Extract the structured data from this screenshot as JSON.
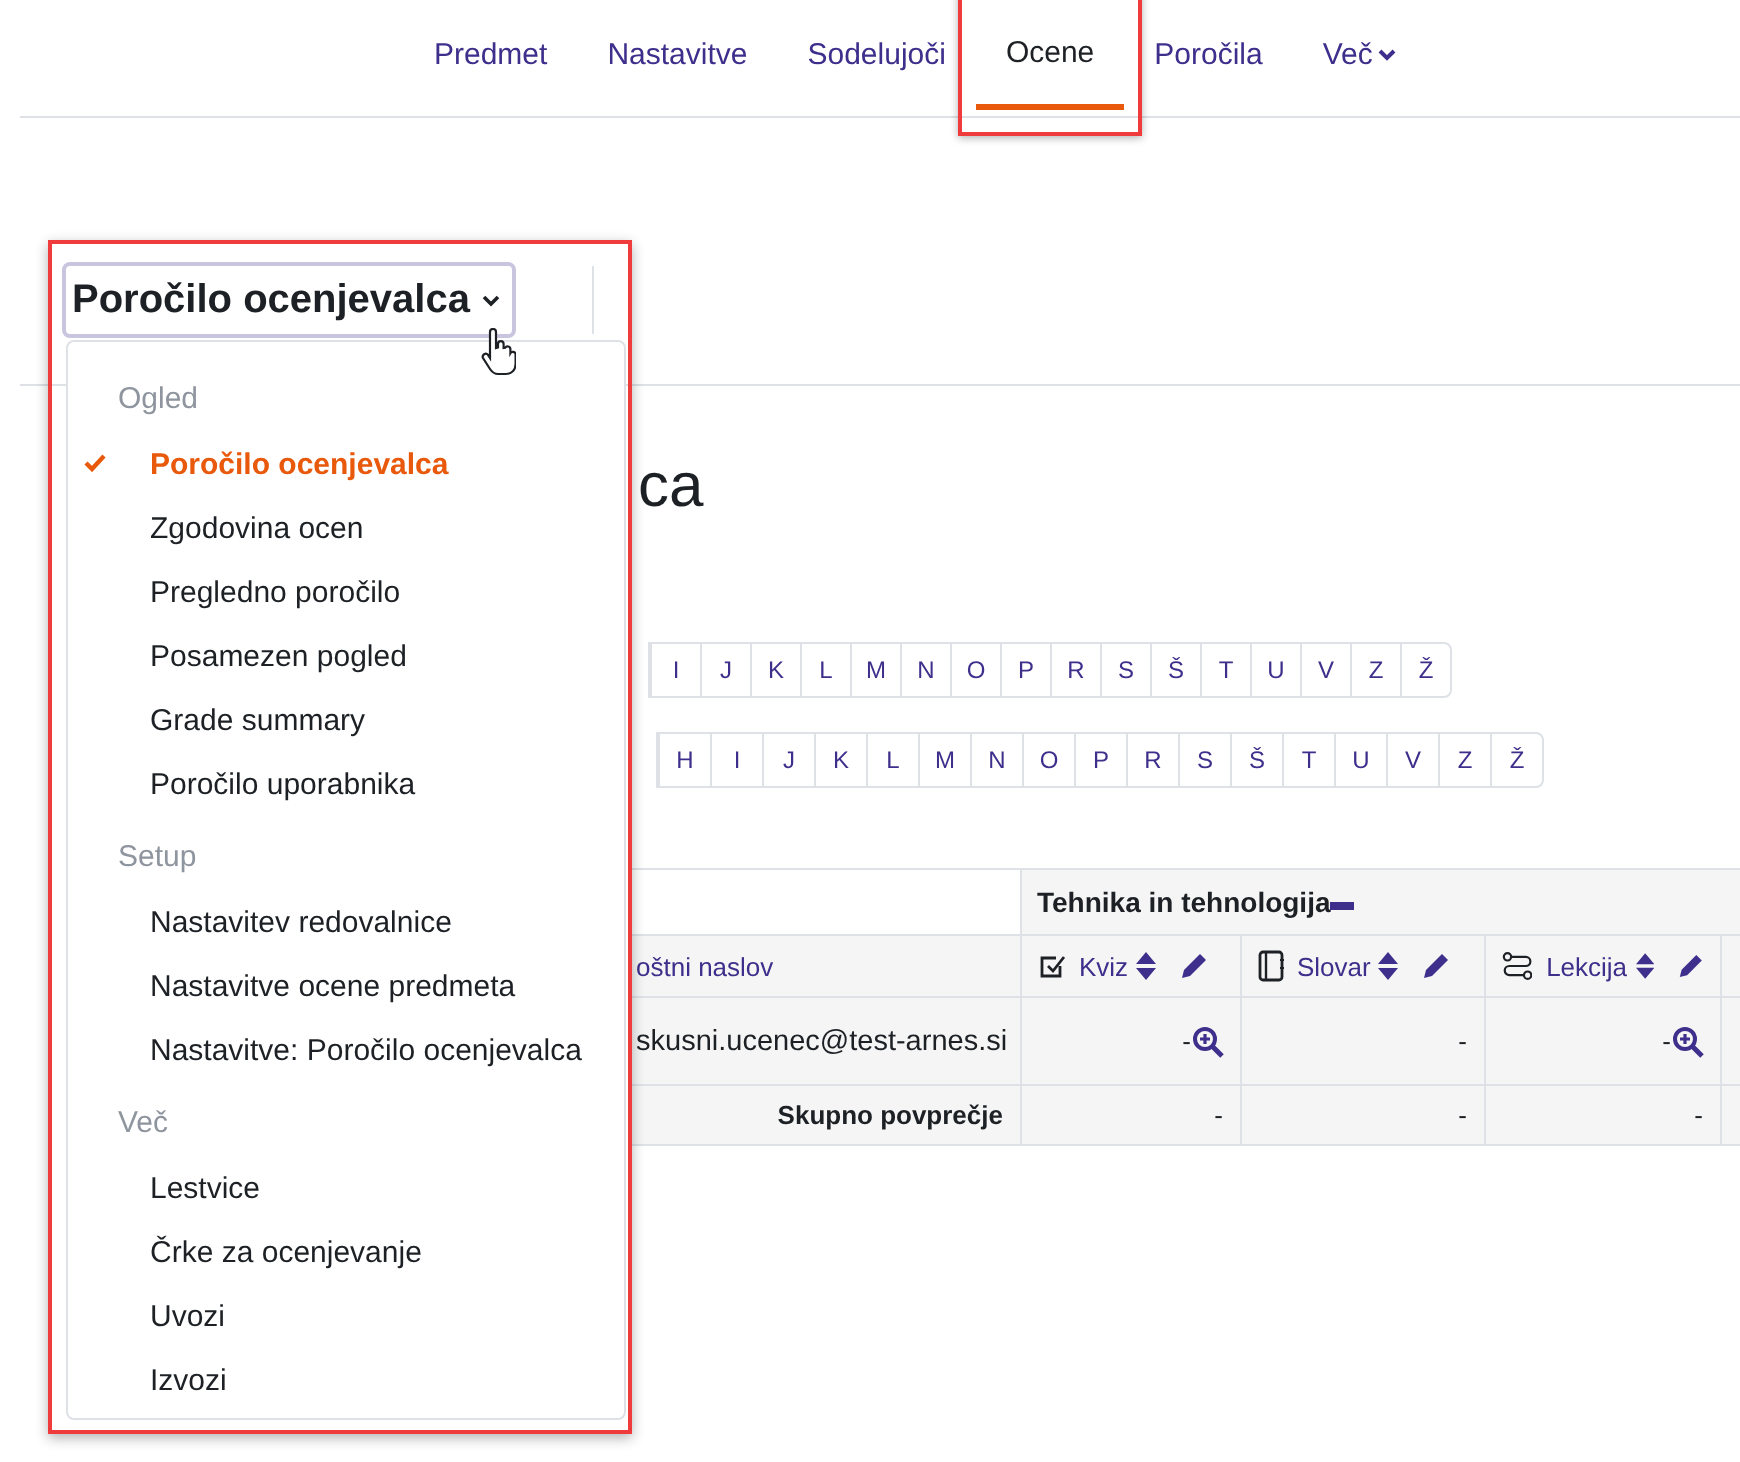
{
  "nav": {
    "tabs": [
      {
        "label": "Predmet",
        "selected": false
      },
      {
        "label": "Nastavitve",
        "selected": false
      },
      {
        "label": "Sodelujoči",
        "selected": false
      },
      {
        "label": "Ocene",
        "selected": true,
        "highlighted": true
      },
      {
        "label": "Poročila",
        "selected": false
      },
      {
        "label": "Več",
        "selected": false,
        "dropdown": true
      }
    ]
  },
  "report_selector": {
    "label": "Poročilo ocenjevalca",
    "highlighted": true,
    "expanded": true,
    "groups": [
      {
        "heading": "Ogled",
        "items": [
          {
            "label": "Poročilo ocenjevalca",
            "selected": true
          },
          {
            "label": "Zgodovina ocen",
            "selected": false
          },
          {
            "label": "Pregledno poročilo",
            "selected": false
          },
          {
            "label": "Posamezen pogled",
            "selected": false
          },
          {
            "label": "Grade summary",
            "selected": false
          },
          {
            "label": "Poročilo uporabnika",
            "selected": false
          }
        ]
      },
      {
        "heading": "Setup",
        "items": [
          {
            "label": "Nastavitev redovalnice",
            "selected": false
          },
          {
            "label": "Nastavitve ocene predmeta",
            "selected": false
          },
          {
            "label": "Nastavitve: Poročilo ocenjevalca",
            "selected": false
          }
        ]
      },
      {
        "heading": "Več",
        "items": [
          {
            "label": "Lestvice",
            "selected": false
          },
          {
            "label": "Črke za ocenjevanje",
            "selected": false
          },
          {
            "label": "Uvozi",
            "selected": false
          },
          {
            "label": "Izvozi",
            "selected": false
          }
        ]
      }
    ]
  },
  "page_title": "ca",
  "letter_filters": [
    {
      "letters": [
        "I",
        "J",
        "K",
        "L",
        "M",
        "N",
        "O",
        "P",
        "R",
        "S",
        "Š",
        "T",
        "U",
        "V",
        "Z",
        "Ž"
      ]
    },
    {
      "letters": [
        "H",
        "I",
        "J",
        "K",
        "L",
        "M",
        "N",
        "O",
        "P",
        "R",
        "S",
        "Š",
        "T",
        "U",
        "V",
        "Z",
        "Ž"
      ]
    }
  ],
  "grader_table": {
    "category": "Tehnika in tehnologija",
    "columns": [
      {
        "label": "oštni naslov",
        "kind": "field"
      },
      {
        "label": "Kviz",
        "kind": "quiz"
      },
      {
        "label": "Slovar",
        "kind": "glossary"
      },
      {
        "label": "Lekcija",
        "kind": "lesson"
      }
    ],
    "rows": [
      {
        "kind": "student",
        "cells": [
          {
            "text": "skusni.ucenec@test-arnes.si"
          },
          {
            "text": "-",
            "zoom": true
          },
          {
            "text": "-"
          },
          {
            "text": "-",
            "zoom": true
          }
        ]
      },
      {
        "kind": "average",
        "cells": [
          {
            "text": "Skupno povprečje"
          },
          {
            "text": "-"
          },
          {
            "text": "-"
          },
          {
            "text": "-"
          }
        ]
      }
    ]
  }
}
